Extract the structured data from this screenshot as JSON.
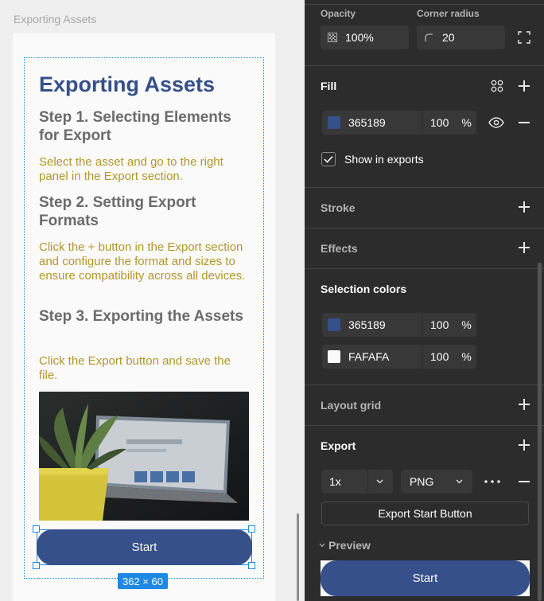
{
  "canvas": {
    "frame_name": "Exporting Assets",
    "doc": {
      "title": "Exporting Assets",
      "step1_heading": "Step 1. Selecting Elements for Export",
      "step1_text": "Select the asset and go to the right panel in the Export section.",
      "step2_heading": "Step 2. Setting Export Formats",
      "step2_text": "Click the + button in the Export section and configure the format and sizes to ensure compatibility across all devices.",
      "step3_heading": "Step 3. Exporting the Assets",
      "step3_text": "Click the Export button and save the file.",
      "start_button": "Start"
    },
    "dimension_badge": "362 × 60"
  },
  "panel": {
    "opacity_label": "Opacity",
    "opacity_value": "100%",
    "corner_radius_label": "Corner radius",
    "corner_radius_value": "20",
    "fill": {
      "title": "Fill",
      "hex": "365189",
      "opacity": "100",
      "pct": "%",
      "color": "#365189",
      "show_in_exports": "Show in exports",
      "show_in_exports_checked": true
    },
    "stroke_title": "Stroke",
    "effects_title": "Effects",
    "selection_colors": {
      "title": "Selection colors",
      "items": [
        {
          "hex": "365189",
          "opacity": "100",
          "pct": "%",
          "color": "#365189"
        },
        {
          "hex": "FAFAFA",
          "opacity": "100",
          "pct": "%",
          "color": "#FAFAFA"
        }
      ]
    },
    "layout_grid_title": "Layout grid",
    "export": {
      "title": "Export",
      "scale": "1x",
      "format": "PNG",
      "button": "Export Start Button",
      "preview_label": "Preview",
      "preview_button": "Start"
    }
  }
}
